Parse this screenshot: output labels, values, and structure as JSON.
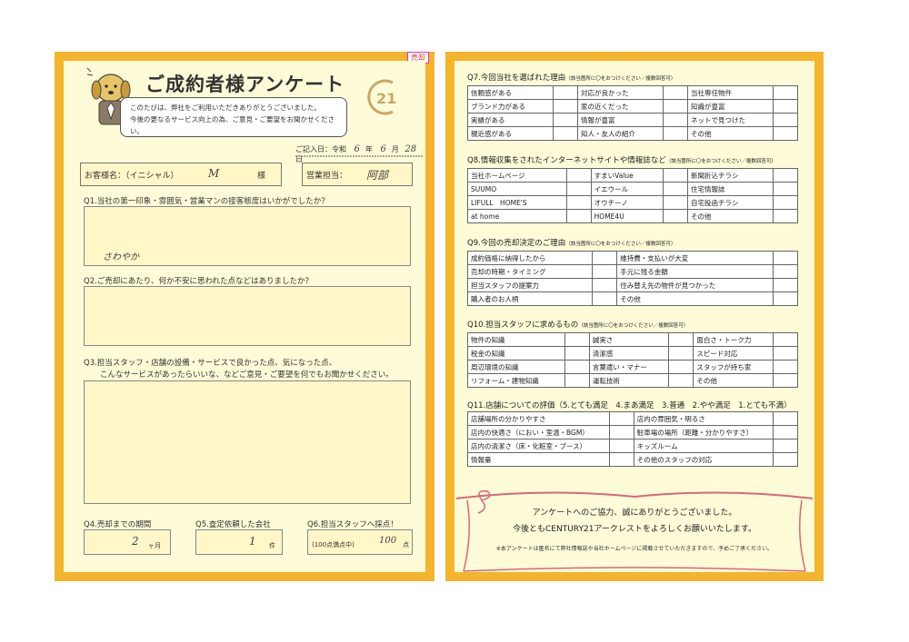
{
  "left": {
    "tag": "売却",
    "title": "ご成約者様アンケート",
    "intro": [
      "このたびは、弊社をご利用いただきありがとうございました。",
      "今後の更なるサービス向上の為、ご意見・ご要望をお聞かせください。"
    ],
    "logo_text": "21",
    "date": {
      "prefix": "ご記入日：令和",
      "year": "6",
      "year_unit": "年",
      "month": "6",
      "month_unit": "月",
      "day": "28",
      "day_unit": "日"
    },
    "customer_label": "お客様名：（イニシャル）",
    "customer_value": "M",
    "customer_suffix": "様",
    "staff_label": "営業担当：",
    "staff_value": "阿部",
    "q1": "Q1.当社の第一印象・雰囲気・営業マンの接客態度はいかがでしたか？",
    "q1_answer": "さわやか",
    "q2": "Q2.ご売却にあたり、何か不安に思われた点などはありましたか？",
    "q3_line1": "Q3.担当スタッフ・店舗の設備・サービスで良かった点、気になった点、",
    "q3_line2": "こんなサービスがあったらいいな、などご意見・ご要望を何でもお聞かせください。",
    "q4": "Q4.売却までの期間",
    "q4_value": "2",
    "q4_unit": "ヶ月",
    "q5": "Q5.査定依頼した会社",
    "q5_value": "1",
    "q5_unit": "件",
    "q6": "Q6.担当スタッフへ採点！",
    "q6_note": "(100点満点中)",
    "q6_value": "100",
    "q6_unit": "点"
  },
  "right": {
    "q7": {
      "title": "Q7.今回当社を選ばれた理由",
      "note": "（該当箇所に〇をおつけください／複数回答可）",
      "rows": [
        [
          "信頼感がある",
          "対応が良かった",
          "当社専任物件"
        ],
        [
          "ブランド力がある",
          "家の近くだった",
          "知識が豊富"
        ],
        [
          "実績がある",
          "情報が豊富",
          "ネットで見つけた"
        ],
        [
          "親近感がある",
          "知人・友人の紹介",
          "その他"
        ]
      ]
    },
    "q8": {
      "title": "Q8.情報収集をされたインターネットサイトや情報誌など",
      "note": "（該当箇所に〇をおつけください／複数回答可）",
      "rows": [
        [
          "当社ホームページ",
          "すまいValue",
          "新聞折込チラシ"
        ],
        [
          "SUUMO",
          "イエウール",
          "住宅情報誌"
        ],
        [
          "LIFULL　HOME'S",
          "オウチーノ",
          "自宅投函チラシ"
        ],
        [
          "at home",
          "HOME4U",
          "その他"
        ]
      ]
    },
    "q9": {
      "title": "Q9.今回の売却決定のご理由",
      "note": "（該当箇所に〇をおつけください／複数回答可）",
      "rows": [
        [
          "成約価格に納得したから",
          "維持費・支払いが大変"
        ],
        [
          "売却の時期・タイミング",
          "手元に残る金額"
        ],
        [
          "担当スタッフの提案力",
          "住み替え先の物件が見つかった"
        ],
        [
          "購入者のお人柄",
          "その他"
        ]
      ]
    },
    "q10": {
      "title": "Q10.担当スタッフに求めるもの",
      "note": "（該当箇所に〇をおつけください／複数回答可）",
      "rows": [
        [
          "物件の知識",
          "誠実さ",
          "面白さ・トーク力"
        ],
        [
          "税金の知識",
          "清潔感",
          "スピード対応"
        ],
        [
          "周辺環境の知識",
          "言葉遣い・マナー",
          "スタッフが持ち家"
        ],
        [
          "リフォーム・建物知識",
          "運転技術",
          "その他"
        ]
      ]
    },
    "q11": {
      "title": "Q11.店舗についての評価（5.とても満足　4.まあ満足　3.普通　2.やや満足　1.とても不満）",
      "rows": [
        [
          "店舗場所の分かりやすさ",
          "店内の雰囲気・明るさ"
        ],
        [
          "店内の快適さ（におい・室温・BGM）",
          "駐車場の場所（距離・分かりやすさ）"
        ],
        [
          "店内の清潔さ（床・化粧室・ブース）",
          "キッズルーム"
        ],
        [
          "情報量",
          "その他のスタッフの対応"
        ]
      ]
    },
    "thanks1": "アンケートへのご協力、誠にありがとうございました。",
    "thanks2": "今後ともCENTURY21アークレストをよろしくお願いいたします。",
    "thanks3": "※本アンケートは匿名にて弊社情報誌や当社ホームページに掲載させていただきますので、予めご了承ください。"
  },
  "colors": {
    "frame": "#f4b42c",
    "panel": "#fdfbd8",
    "ribbon": "#d9667a",
    "logo": "#c9a868"
  }
}
